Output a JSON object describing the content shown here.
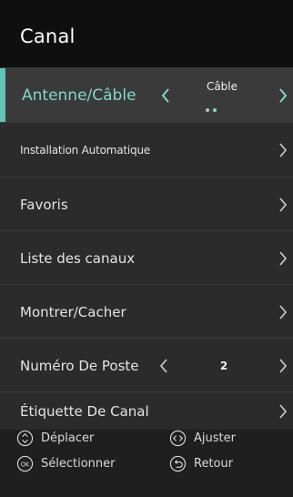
{
  "header": {
    "title": "Canal"
  },
  "menu": {
    "items": [
      {
        "label": "Antenne/Câble",
        "value": "Câble",
        "page_indicator": 2
      },
      {
        "label": "Installation Automatique"
      },
      {
        "label": "Favoris"
      },
      {
        "label": "Liste des canaux"
      },
      {
        "label": "Montrer/Cacher"
      },
      {
        "label": "Numéro De Poste",
        "value": "2"
      },
      {
        "label": "Étiquette De Canal"
      }
    ]
  },
  "footer": {
    "hints": [
      {
        "icon": "updown-icon",
        "label": "Déplacer"
      },
      {
        "icon": "leftright-icon",
        "label": "Ajuster"
      },
      {
        "icon": "ok-icon",
        "label": "Sélectionner"
      },
      {
        "icon": "back-icon",
        "label": "Retour"
      }
    ]
  },
  "colors": {
    "accent": "#64c3b8",
    "accent_text": "#7fd6cc",
    "header_bg": "#0f0f0f",
    "row_bg": "#2b2b2b",
    "active_row_bg": "#3a3a3a"
  }
}
